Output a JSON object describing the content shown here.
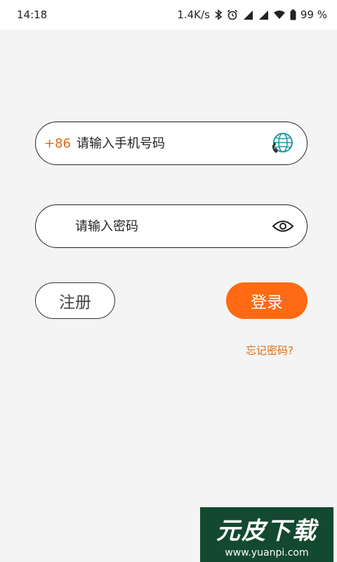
{
  "status_bar": {
    "time": "14:18",
    "net_speed": "1.4K/s",
    "battery_percent": "99 %"
  },
  "login": {
    "country_code": "+86",
    "phone_placeholder": "请输入手机号码",
    "password_placeholder": "请输入密码",
    "register_label": "注册",
    "login_label": "登录",
    "forgot_label": "忘记密码?"
  },
  "colors": {
    "accent": "#ff6a12",
    "link": "#e06a0f",
    "background": "#f4f4f4"
  },
  "icons": {
    "phone_field_icon": "globe-phone-icon",
    "password_toggle_icon": "eye-icon"
  },
  "watermark": {
    "title": "元皮下载",
    "url": "www.yuanpi.com"
  }
}
